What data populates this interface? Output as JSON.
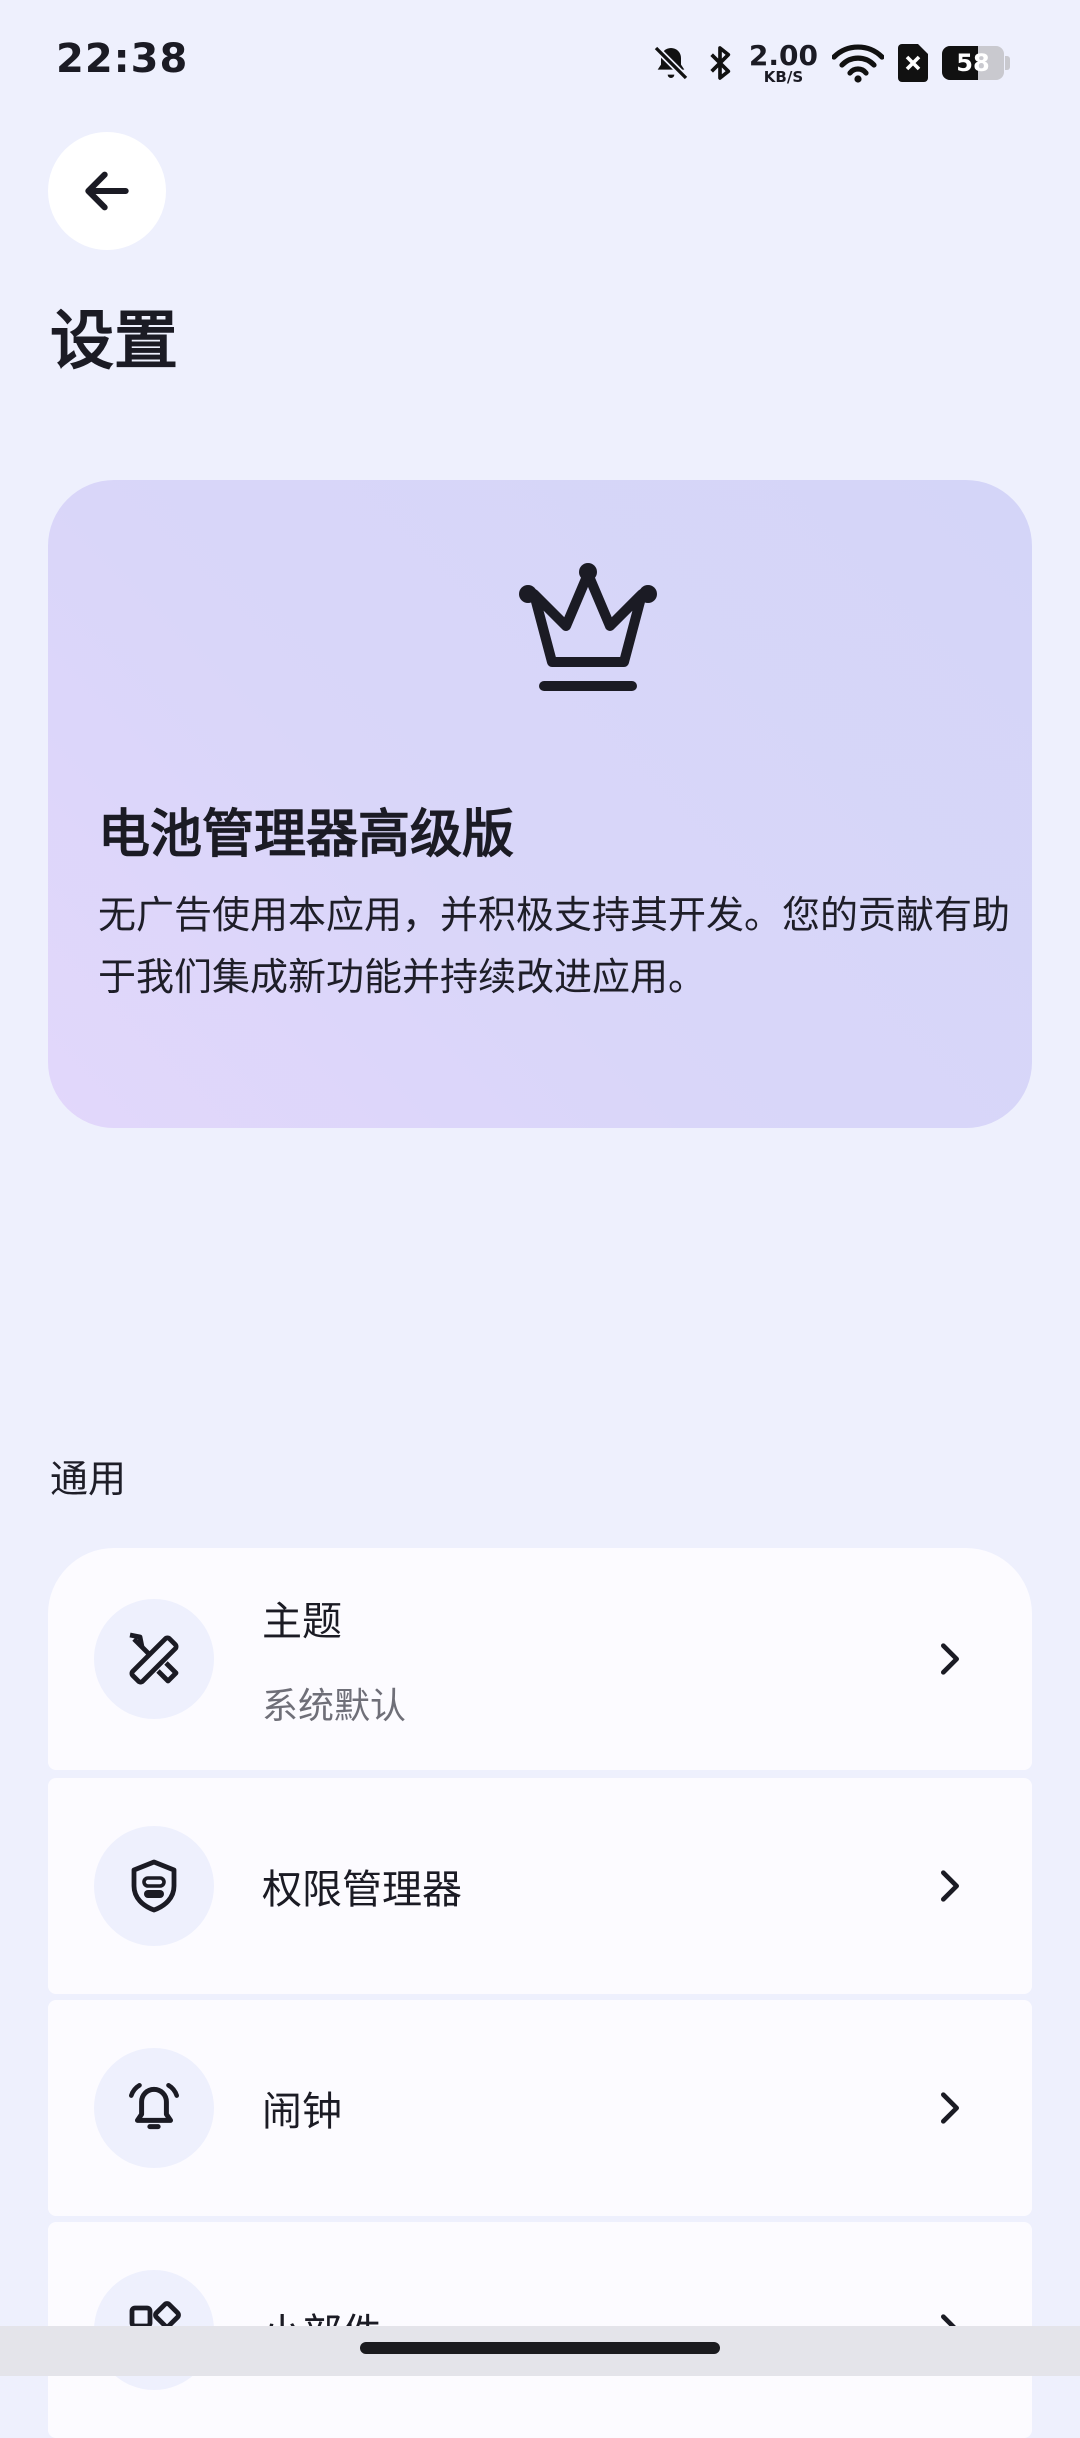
{
  "status_bar": {
    "time": "22:38",
    "net_speed_value": "2.00",
    "net_speed_unit": "KB/S",
    "battery_level": "58",
    "battery_fraction": 0.58,
    "icons": [
      "bell-off-icon",
      "bluetooth-icon",
      "wifi-icon",
      "sim-blocked-icon",
      "battery-icon"
    ]
  },
  "header": {
    "back_icon": "arrow-left-icon",
    "title": "设置"
  },
  "premium_card": {
    "icon": "crown-icon",
    "title": "电池管理器高级版",
    "description": "无广告使用本应用，并积极支持其开发。您的贡献有助于我们集成新功能并持续改进应用。"
  },
  "general_section": {
    "label": "通用",
    "items": [
      {
        "icon": "design-tools-icon",
        "label": "主题",
        "subtitle": "系统默认"
      },
      {
        "icon": "shield-icon",
        "label": "权限管理器"
      },
      {
        "icon": "alarm-bell-icon",
        "label": "闹钟"
      },
      {
        "icon": "widgets-icon",
        "label": "小部件"
      }
    ]
  },
  "colors": {
    "background": "#eef0fd",
    "card": "#fcfbff",
    "premium_gradient_start": "#e2d7fb",
    "premium_gradient_end": "#d4d5f8",
    "text_primary": "#1b1b24",
    "text_secondary": "#6f6f78"
  }
}
